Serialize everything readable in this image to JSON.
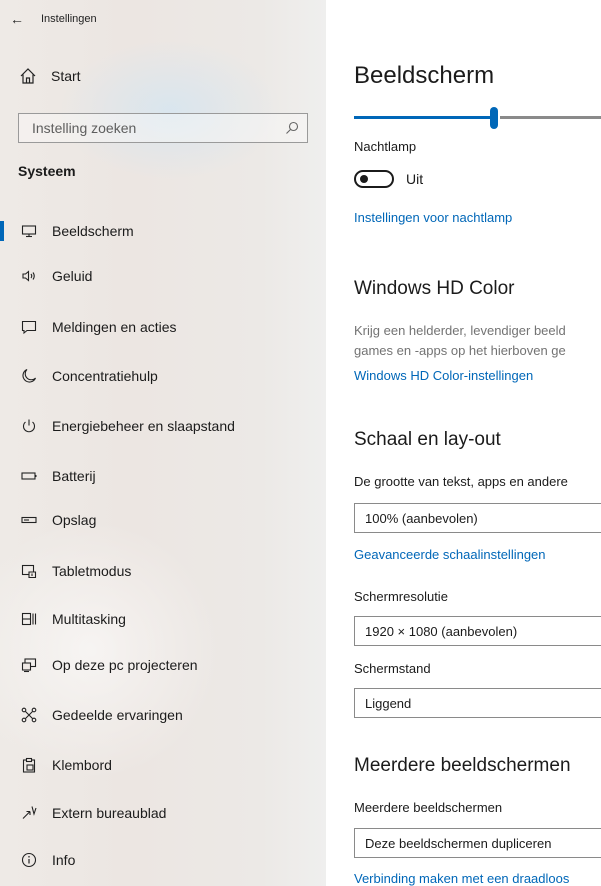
{
  "window": {
    "title": "Instellingen"
  },
  "sidebar": {
    "home": "Start",
    "search_placeholder": "Instelling zoeken",
    "section": "Systeem",
    "items": [
      {
        "label": "Beeldscherm",
        "icon": "monitor-icon",
        "selected": true
      },
      {
        "label": "Geluid",
        "icon": "speaker-icon"
      },
      {
        "label": "Meldingen en acties",
        "icon": "notification-icon"
      },
      {
        "label": "Concentratiehulp",
        "icon": "moon-icon"
      },
      {
        "label": "Energiebeheer en slaapstand",
        "icon": "power-icon"
      },
      {
        "label": "Batterij",
        "icon": "battery-icon"
      },
      {
        "label": "Opslag",
        "icon": "storage-icon"
      },
      {
        "label": "Tabletmodus",
        "icon": "tablet-mode-icon"
      },
      {
        "label": "Multitasking",
        "icon": "multitasking-icon"
      },
      {
        "label": "Op deze pc projecteren",
        "icon": "project-icon"
      },
      {
        "label": "Gedeelde ervaringen",
        "icon": "shared-experiences-icon"
      },
      {
        "label": "Klembord",
        "icon": "clipboard-icon"
      },
      {
        "label": "Extern bureaublad",
        "icon": "remote-desktop-icon"
      },
      {
        "label": "Info",
        "icon": "info-icon"
      }
    ]
  },
  "main": {
    "title": "Beeldscherm",
    "brightness_fraction": 0.54,
    "night_light": {
      "label": "Nachtlamp",
      "state": "Uit",
      "settings_link": "Instellingen voor nachtlamp"
    },
    "hd_color": {
      "heading": "Windows HD Color",
      "desc_line1": "Krijg een helderder, levendiger beeld",
      "desc_line2": "games en -apps op het hierboven ge",
      "link": "Windows HD Color-instellingen"
    },
    "scale": {
      "heading": "Schaal en lay-out",
      "size_label": "De grootte van tekst, apps en andere",
      "size_value": "100% (aanbevolen)",
      "advanced_link": "Geavanceerde schaalinstellingen",
      "resolution_label": "Schermresolutie",
      "resolution_value": "1920 × 1080 (aanbevolen)",
      "orientation_label": "Schermstand",
      "orientation_value": "Liggend"
    },
    "multi": {
      "heading": "Meerdere beeldschermen",
      "label": "Meerdere beeldschermen",
      "value": "Deze beeldschermen dupliceren",
      "link": "Verbinding maken met een draadloos"
    }
  },
  "colors": {
    "accent": "#0067b8"
  }
}
